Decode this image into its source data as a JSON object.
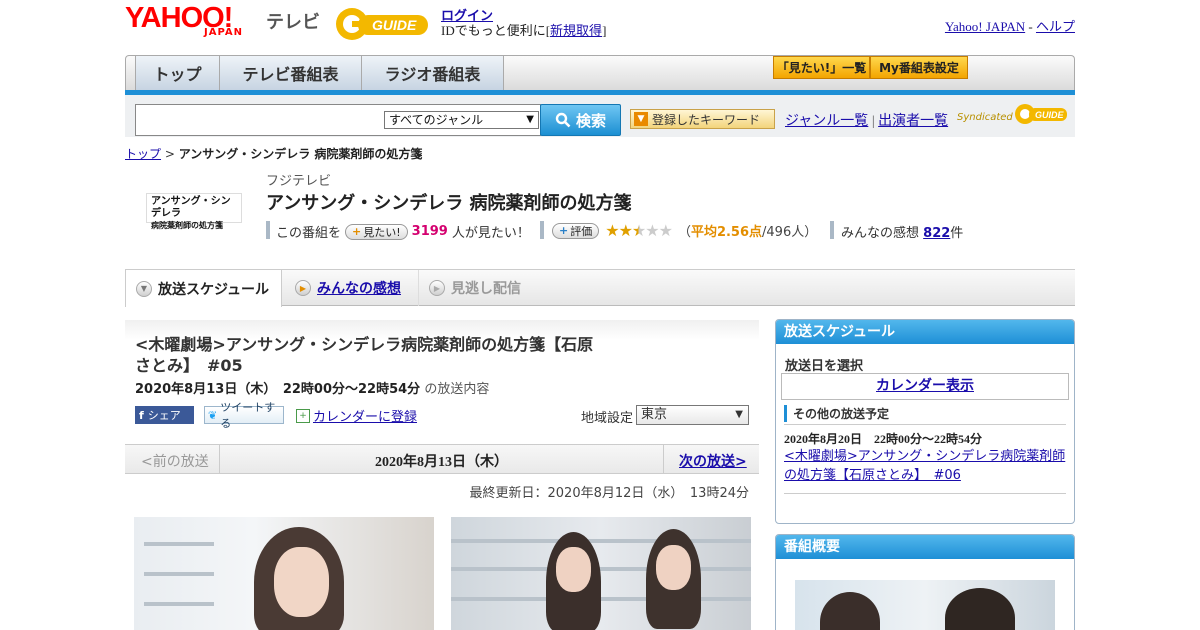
{
  "header": {
    "yahoo_logo": "YAHOO!",
    "yahoo_japan": "JAPAN",
    "tv_label": "テレビ",
    "gguide_logo": "G GUIDE",
    "login": "ログイン",
    "id_prefix": "IDでもっと便利に[",
    "register": "新規取得",
    "id_suffix": "]",
    "yahoo_japan_link": "Yahoo! JAPAN",
    "separator": "-",
    "help": "ヘルプ"
  },
  "nav": {
    "top": "トップ",
    "tv_guide": "テレビ番組表",
    "radio_guide": "ラジオ番組表",
    "mitai_list": "「見たい!」一覧",
    "my_guide": "My番組表設定"
  },
  "search": {
    "input_value": "",
    "genre_selected": "すべてのジャンル",
    "button": "検索",
    "keyword_button": "登録したキーワード",
    "genre_list": "ジャンル一覧",
    "divider": "|",
    "performer_list": "出演者一覧",
    "syndicated": "Syndicated",
    "synd_logo": "G GUIDE"
  },
  "breadcrumb": {
    "home": "トップ",
    "sep": ">",
    "current": "アンサング・シンデレラ 病院薬剤師の処方箋"
  },
  "program": {
    "thumb_line1": "アンサング・シンデレラ",
    "thumb_line2": "病院薬剤師の処方箋",
    "station": "フジテレビ",
    "title": "アンサング・シンデレラ 病院薬剤師の処方箋",
    "mitai_prefix": "この番組を",
    "mitai_button": "見たい!",
    "mitai_count": "3199",
    "mitai_suffix": "人が見たい！",
    "rate_button": "評価",
    "rating_avg_label": "平均2.56点",
    "rating_open": "（",
    "rating_count": "/496人）",
    "rating_value": 2.56,
    "reviews_label": "みんなの感想",
    "reviews_count": "822",
    "reviews_suffix": "件"
  },
  "subtabs": {
    "schedule": "放送スケジュール",
    "reviews": "みんなの感想",
    "missed": "見逃し配信"
  },
  "episode": {
    "title": "<木曜劇場>アンサング・シンデレラ病院薬剤師の処方箋【石原さとみ】　#05",
    "date": "2020年8月13日（木）　22時00分～22時54分",
    "date_suffix": "の放送内容",
    "share_fb": "シェア",
    "share_tw": "ツイートする",
    "calendar": "カレンダーに登録",
    "region_label": "地域設定",
    "region_value": "東京",
    "prev": "<前の放送",
    "nav_date": "2020年8月13日（木）",
    "next": "次の放送>",
    "last_update": "最終更新日：2020年8月12日（水）　13時24分"
  },
  "sidebar": {
    "schedule_head": "放送スケジュール",
    "date_select": "放送日を選択",
    "calendar_btn": "カレンダー表示",
    "other_label": "その他の放送予定",
    "other_date": "2020年8月20日　22時00分～22時54分",
    "other_title": "<木曜劇場>アンサング・シンデレラ病院薬剤師の処方箋【石原さとみ】　#06",
    "summary_head": "番組概要"
  },
  "colors": {
    "accent_blue": "#1e8fd6",
    "link": "#1a0dab",
    "mitai_pink": "#d4006f",
    "star_gold": "#e0a000"
  }
}
